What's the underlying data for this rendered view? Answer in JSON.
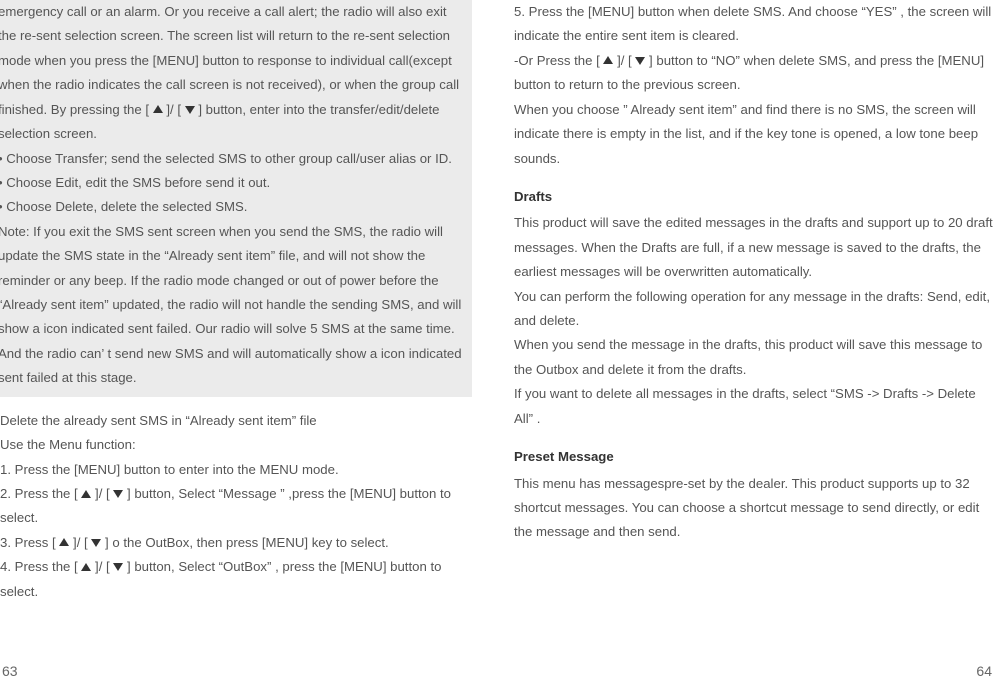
{
  "left": {
    "hl_p1": "emergency call or an alarm. Or you receive a call alert; the radio will also exit the re-sent selection screen. The screen list will return to the re-sent selection mode when you press the [MENU] button to response to individual call(except when the radio  indicates the call screen is not received), or when the group call finished. By pressing the [ ▲ ]/ [ ▼ ] button, enter into the transfer/edit/delete selection screen.",
    "hl_b1": "• Choose Transfer; send the selected SMS to other group call/user alias or ID.",
    "hl_b2": "• Choose Edit, edit the SMS before send it out.",
    "hl_b3": "• Choose Delete, delete the selected SMS.",
    "hl_note": "Note: If you exit the SMS sent screen when you send the SMS, the radio will update the SMS state in the “Already sent item” file, and will not show the reminder or any beep. If the radio mode changed or out of power before the “Already sent item” updated, the radio will not handle the sending SMS, and will show a icon indicated sent failed. Our radio will solve 5 SMS at the same time. And the radio can’ t send new SMS and will automatically show a icon indicated sent failed at this stage.",
    "subhead": " Delete the already sent SMS in “Already sent item” file",
    "use_menu": "Use the Menu function:",
    "s1": "1. Press the [MENU] button to enter into the MENU mode.",
    "s2a": "2. Press the [ ",
    "s2b": " ]/ [ ",
    "s2c": " ] button, Select  “Message ” ,press the [MENU] button to select.",
    "s3a": "3. Press [ ",
    "s3b": " ]/ [ ",
    "s3c": " ] o the OutBox, then press [MENU] key to select.",
    "s4a": "4. Press the [ ",
    "s4b": " ]/ [ ",
    "s4c": " ] button, Select “OutBox” , press the [MENU] button to select.",
    "pagenum": "63"
  },
  "right": {
    "s5": "5. Press the [MENU] button when delete SMS.  And choose “YES” , the screen will indicate the entire sent item is cleared.",
    "s5b_a": "-Or Press the [ ",
    "s5b_b": " ]/ [ ",
    "s5b_c": " ] button to “NO” when delete SMS, and press the [MENU] button to return to the previous screen.",
    "s5c": "When you choose ” Already sent item” and find there is no SMS, the screen will indicate there is empty in the list, and if the key tone is opened, a low tone beep sounds.",
    "drafts_title": "Drafts",
    "drafts_p1": "This product will save the edited messages in the drafts and support up to 20 draft messages. When the Drafts are full, if a new message is saved to the drafts, the earliest messages will be overwritten automatically.",
    "drafts_p2": "You can perform the following operation for any message in the drafts: Send, edit, and delete.",
    "drafts_p3": "When you send the message in the drafts, this product will save this message to the Outbox and delete it from the drafts.",
    "drafts_p4": "If you want to delete all messages in the drafts, select “SMS -> Drafts -> Delete All” .",
    "preset_title": "Preset Message",
    "preset_p": "This menu has messagespre-set by the dealer. This product supports up to 32 shortcut messages. You can choose a shortcut message to send directly, or edit the message and then send.",
    "pagenum": "64"
  }
}
